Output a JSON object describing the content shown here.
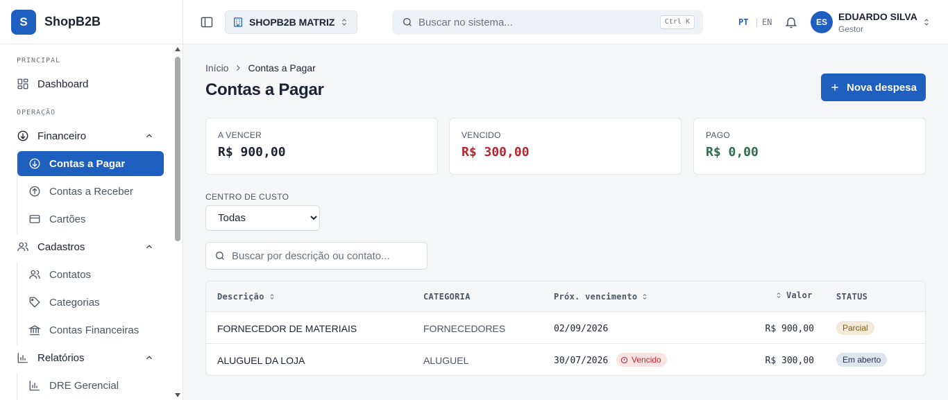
{
  "brand": {
    "logo_letter": "S",
    "name": "ShopB2B"
  },
  "sidebar": {
    "sections": {
      "principal": "PRINCIPAL",
      "operacao": "OPERAÇÃO"
    },
    "items": {
      "dashboard": "Dashboard",
      "financeiro": "Financeiro",
      "contas_pagar": "Contas a Pagar",
      "contas_receber": "Contas a Receber",
      "cartoes": "Cartões",
      "cadastros": "Cadastros",
      "contatos": "Contatos",
      "categorias": "Categorias",
      "contas_financeiras": "Contas Financeiras",
      "relatorios": "Relatórios",
      "dre": "DRE Gerencial"
    }
  },
  "topbar": {
    "store": "SHOPB2B MATRIZ",
    "search_placeholder": "Buscar no sistema...",
    "shortcut": "Ctrl K",
    "lang_pt": "PT",
    "lang_sep": "|",
    "lang_en": "EN",
    "user": {
      "initials": "ES",
      "name": "EDUARDO SILVA",
      "role": "Gestor"
    }
  },
  "main": {
    "breadcrumb": {
      "home": "Início",
      "current": "Contas a Pagar"
    },
    "title": "Contas a Pagar",
    "new_button": "Nova despesa",
    "cards": [
      {
        "label": "A VENCER",
        "value": "R$ 900,00",
        "color": "#1b2232"
      },
      {
        "label": "VENCIDO",
        "value": "R$ 300,00",
        "color": "#b3262d"
      },
      {
        "label": "PAGO",
        "value": "R$ 0,00",
        "color": "#2f6b4a"
      }
    ],
    "filter": {
      "label": "CENTRO DE CUSTO",
      "selected": "Todas"
    },
    "table_search_placeholder": "Buscar por descrição ou contato...",
    "table": {
      "headers": {
        "descricao": "Descrição",
        "categoria": "CATEGORIA",
        "vencimento": "Próx. vencimento",
        "valor": "Valor",
        "status": "STATUS"
      },
      "rows": [
        {
          "descricao": "FORNECEDOR DE MATERIAIS",
          "categoria": "FORNECEDORES",
          "vencimento": "02/09/2026",
          "overdue": "",
          "valor": "R$ 900,00",
          "status": "Parcial"
        },
        {
          "descricao": "ALUGUEL DA LOJA",
          "categoria": "ALUGUEL",
          "vencimento": "30/07/2026",
          "overdue": "Vencido",
          "valor": "R$ 300,00",
          "status": "Em aberto"
        }
      ]
    }
  },
  "colors": {
    "accent": "#1f5fbf",
    "danger": "#b3262d",
    "success": "#2f6b4a"
  }
}
